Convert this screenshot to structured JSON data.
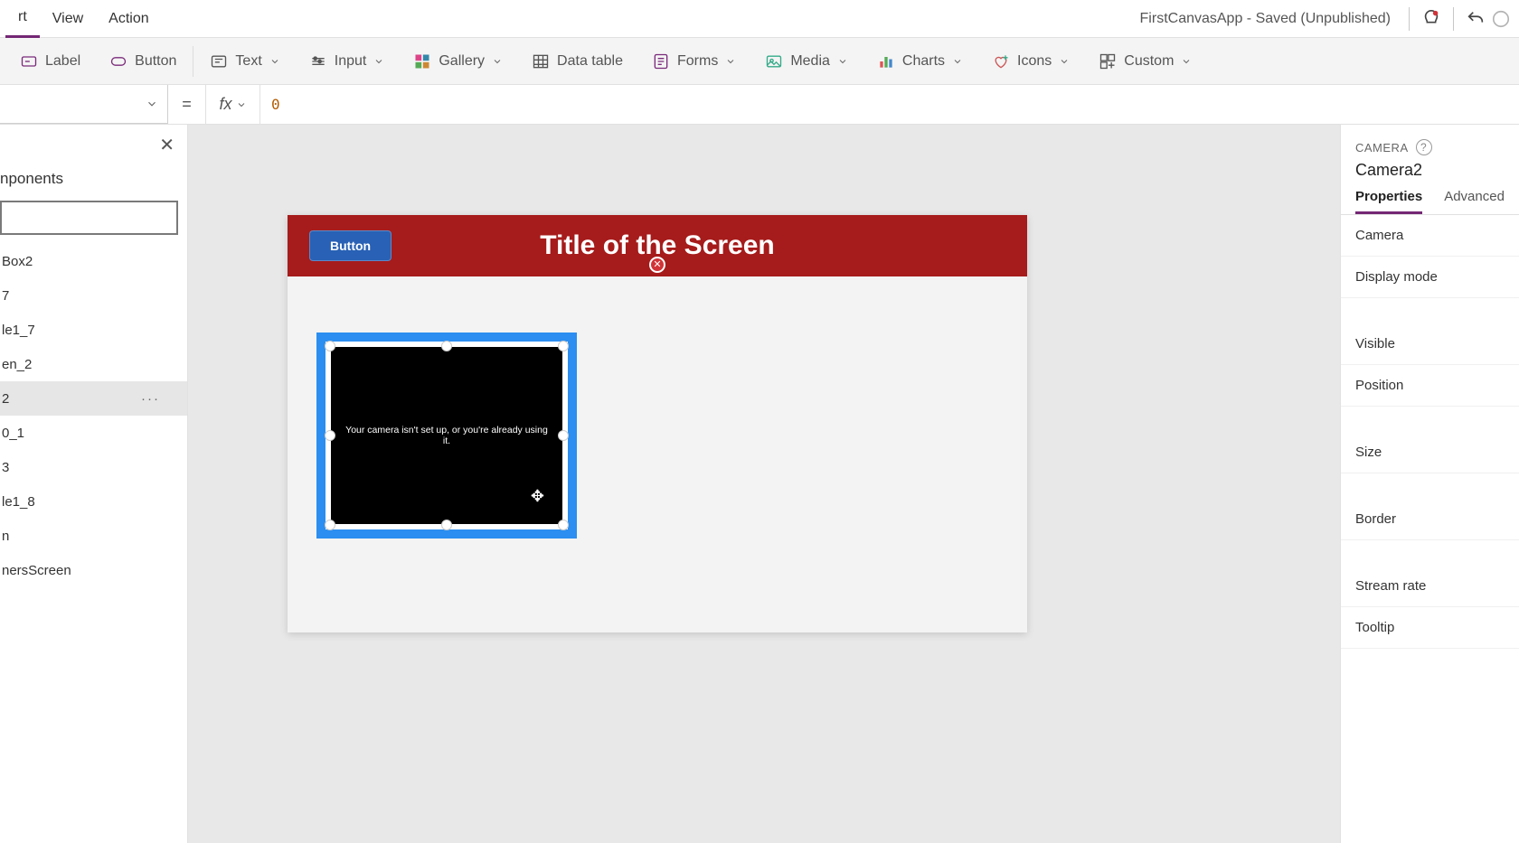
{
  "tabs": {
    "insert": "rt",
    "view": "View",
    "action": "Action"
  },
  "app_status": "FirstCanvasApp - Saved (Unpublished)",
  "ribbon": {
    "label": "Label",
    "button": "Button",
    "text": "Text",
    "input": "Input",
    "gallery": "Gallery",
    "data_table": "Data table",
    "forms": "Forms",
    "media": "Media",
    "charts": "Charts",
    "icons": "Icons",
    "custom": "Custom"
  },
  "formula": {
    "fx": "fx",
    "value": "0"
  },
  "tree": {
    "header": "nponents",
    "items": [
      "Box2",
      "7",
      "le1_7",
      "en_2",
      "2",
      "0_1",
      "3",
      "le1_8",
      "n",
      "nersScreen"
    ],
    "selected_index": 4
  },
  "canvas": {
    "button_label": "Button",
    "title": "Title of the Screen",
    "camera_msg": "Your camera isn't set up, or you're already using it."
  },
  "props": {
    "type": "CAMERA",
    "name": "Camera2",
    "tab_properties": "Properties",
    "tab_advanced": "Advanced",
    "rows": [
      "Camera",
      "Display mode",
      "Visible",
      "Position",
      "Size",
      "Border",
      "Stream rate",
      "Tooltip"
    ]
  }
}
